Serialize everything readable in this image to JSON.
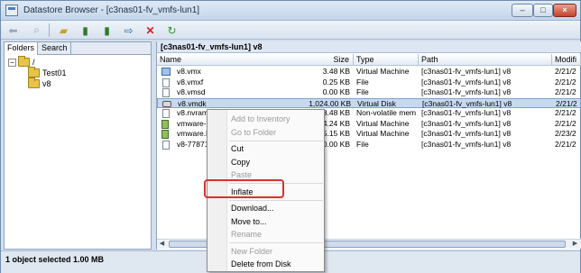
{
  "window": {
    "title": "Datastore Browser - [c3nas01-fv_vmfs-lun1]",
    "minimize": "–",
    "maximize": "□",
    "close": "×"
  },
  "left_pane": {
    "tabs": [
      "Folders",
      "Search"
    ],
    "tree": [
      {
        "label": "/",
        "expander": "−"
      },
      {
        "label": "Test01"
      },
      {
        "label": "v8"
      }
    ]
  },
  "right_pane": {
    "path": "[c3nas01-fv_vmfs-lun1] v8",
    "columns": [
      "Name",
      "Size",
      "Type",
      "Path",
      "Modifi"
    ],
    "rows": [
      {
        "icon": "vm-icon",
        "name": "v8.vmx",
        "size": "3.48 KB",
        "type": "Virtual Machine",
        "path": "[c3nas01-fv_vmfs-lun1] v8",
        "modified": "2/21/2"
      },
      {
        "icon": "file-icon",
        "name": "v8.vmxf",
        "size": "0.25 KB",
        "type": "File",
        "path": "[c3nas01-fv_vmfs-lun1] v8",
        "modified": "2/21/2"
      },
      {
        "icon": "file-icon",
        "name": "v8.vmsd",
        "size": "0.00 KB",
        "type": "File",
        "path": "[c3nas01-fv_vmfs-lun1] v8",
        "modified": "2/21/2"
      },
      {
        "icon": "disk-icon",
        "name": "v8.vmdk",
        "size": "1,024.00 KB",
        "type": "Virtual Disk",
        "path": "[c3nas01-fv_vmfs-lun1] v8",
        "modified": "2/21/2",
        "selected": true
      },
      {
        "icon": "file-icon",
        "name": "v8.nvram",
        "size": "8.48 KB",
        "type": "Non-volatile mem",
        "path": "[c3nas01-fv_vmfs-lun1] v8",
        "modified": "2/21/2"
      },
      {
        "icon": "green-icon",
        "name": "vmware-",
        "size": "64.24 KB",
        "type": "Virtual Machine",
        "path": "[c3nas01-fv_vmfs-lun1] v8",
        "modified": "2/21/2"
      },
      {
        "icon": "green-icon",
        "name": "vmware.l",
        "size": "95.15 KB",
        "type": "Virtual Machine",
        "path": "[c3nas01-fv_vmfs-lun1] v8",
        "modified": "2/23/2"
      },
      {
        "icon": "file-icon",
        "name": "v8-77871",
        "size": "80.00 KB",
        "type": "File",
        "path": "[c3nas01-fv_vmfs-lun1] v8",
        "modified": "2/21/2"
      }
    ]
  },
  "status": {
    "text": "1 object selected 1.00 MB"
  },
  "context_menu": {
    "items": [
      {
        "label": "Add to Inventory",
        "disabled": true
      },
      {
        "label": "Go to Folder",
        "disabled": true
      },
      {
        "label": "Cut",
        "disabled": false
      },
      {
        "label": "Copy",
        "disabled": false
      },
      {
        "label": "Paste",
        "disabled": true
      },
      {
        "label": "Inflate",
        "disabled": false
      },
      {
        "label": "Download...",
        "disabled": false
      },
      {
        "label": "Move to...",
        "disabled": false
      },
      {
        "label": "Rename",
        "disabled": true
      },
      {
        "label": "New Folder",
        "disabled": true
      },
      {
        "label": "Delete from Disk",
        "disabled": false
      }
    ]
  },
  "colors": {
    "highlight_box": "#d9312c",
    "selection": "#c6d9f1"
  }
}
